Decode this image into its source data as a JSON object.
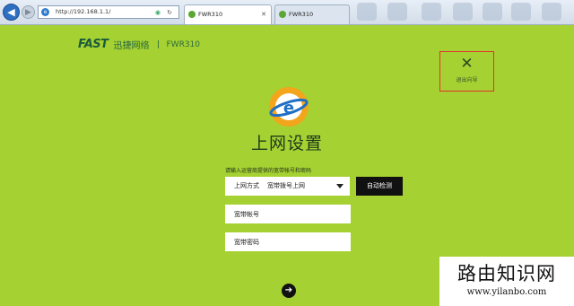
{
  "browser": {
    "address": "http://192.168.1.1/",
    "tabs": [
      {
        "label": "FWR310"
      },
      {
        "label": "FWR310"
      }
    ]
  },
  "brand": {
    "logo_text": "FAST",
    "name_cn": "迅捷网络",
    "model": "FWR310"
  },
  "exit_wizard": {
    "label": "退出向导"
  },
  "page": {
    "title": "上网设置",
    "hint": "请输入运营商提供的宽带帐号和密码"
  },
  "form": {
    "connection_type": {
      "label": "上网方式",
      "value": "宽带拨号上网"
    },
    "auto_detect_label": "自动检测",
    "account_placeholder": "宽带帐号",
    "password_placeholder": "宽带密码"
  },
  "watermark": {
    "title": "路由知识网",
    "url": "www.yilanbo.com"
  },
  "colors": {
    "background": "#a6d132",
    "accent_red": "#e4332d",
    "button_black": "#111111"
  }
}
